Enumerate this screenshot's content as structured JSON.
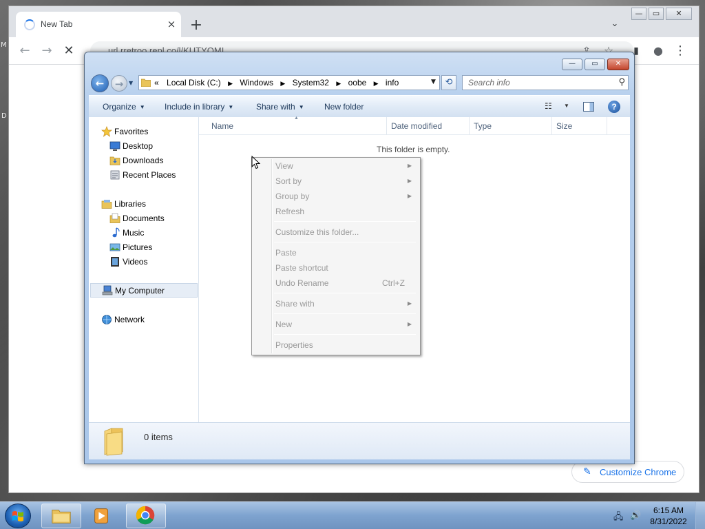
{
  "desktop": {
    "side_labels": [
      "M",
      "D"
    ]
  },
  "chrome": {
    "tab_title": "New Tab",
    "tab_close": "×",
    "new_tab": "+",
    "tab_search": "⌄",
    "url": "url.rretroo.repl.co/l/KUTYOMI",
    "back_icon": "←",
    "forward_icon": "→",
    "stop_icon": "✕",
    "share_icon": "⇪",
    "star_icon": "☆",
    "sidepanel_icon": "▮",
    "profile_icon": "●",
    "menu_icon": "⋮",
    "customize_label": "Customize Chrome",
    "pen_icon": "✎",
    "window_controls": {
      "minimize": "—",
      "maximize": "▭",
      "close": "✕"
    }
  },
  "explorer": {
    "window_controls": {
      "minimize": "—",
      "maximize": "▭",
      "close": "✕"
    },
    "back_icon": "←",
    "forward_icon": "→",
    "breadcrumb_prefix": "«",
    "breadcrumbs": [
      "Local Disk (C:)",
      "Windows",
      "System32",
      "oobe",
      "info"
    ],
    "breadcrumb_separator": "▶",
    "address_dropdown": "▼",
    "refresh_icon": "⟲",
    "search_placeholder": "Search info",
    "search_icon": "⚲",
    "commands": {
      "organize": "Organize",
      "include_in_library": "Include in library",
      "share_with": "Share with",
      "new_folder": "New folder",
      "dropdown_arrow": "▼"
    },
    "views_icon": "☷",
    "help_icon": "?",
    "nav": {
      "favorites": "Favorites",
      "desktop": "Desktop",
      "downloads": "Downloads",
      "recent_places": "Recent Places",
      "libraries": "Libraries",
      "documents": "Documents",
      "music": "Music",
      "pictures": "Pictures",
      "videos": "Videos",
      "my_computer": "My Computer",
      "network": "Network"
    },
    "columns": [
      "Name",
      "Date modified",
      "Type",
      "Size"
    ],
    "sort_caret": "▲",
    "empty_message": "This folder is empty.",
    "status_count": "0 items"
  },
  "context_menu": {
    "items": [
      {
        "label": "View",
        "submenu": true
      },
      {
        "label": "Sort by",
        "submenu": true
      },
      {
        "label": "Group by",
        "submenu": true
      },
      {
        "label": "Refresh"
      },
      {
        "label": "Customize this folder..."
      },
      {
        "label": "Paste"
      },
      {
        "label": "Paste shortcut"
      },
      {
        "label": "Undo Rename",
        "shortcut": "Ctrl+Z"
      },
      {
        "label": "Share with",
        "submenu": true
      },
      {
        "label": "New",
        "submenu": true
      },
      {
        "label": "Properties"
      }
    ],
    "submenu_arrow": "▶"
  },
  "taskbar": {
    "tray_network_icon": "🖧",
    "tray_volume_icon": "🔊",
    "time": "6:15 AM",
    "date": "8/31/2022"
  },
  "colors": {
    "explorer_frame": "#b9d1ee",
    "chrome_accent": "#1a73e8",
    "taskbar": "#7ea3cf"
  }
}
